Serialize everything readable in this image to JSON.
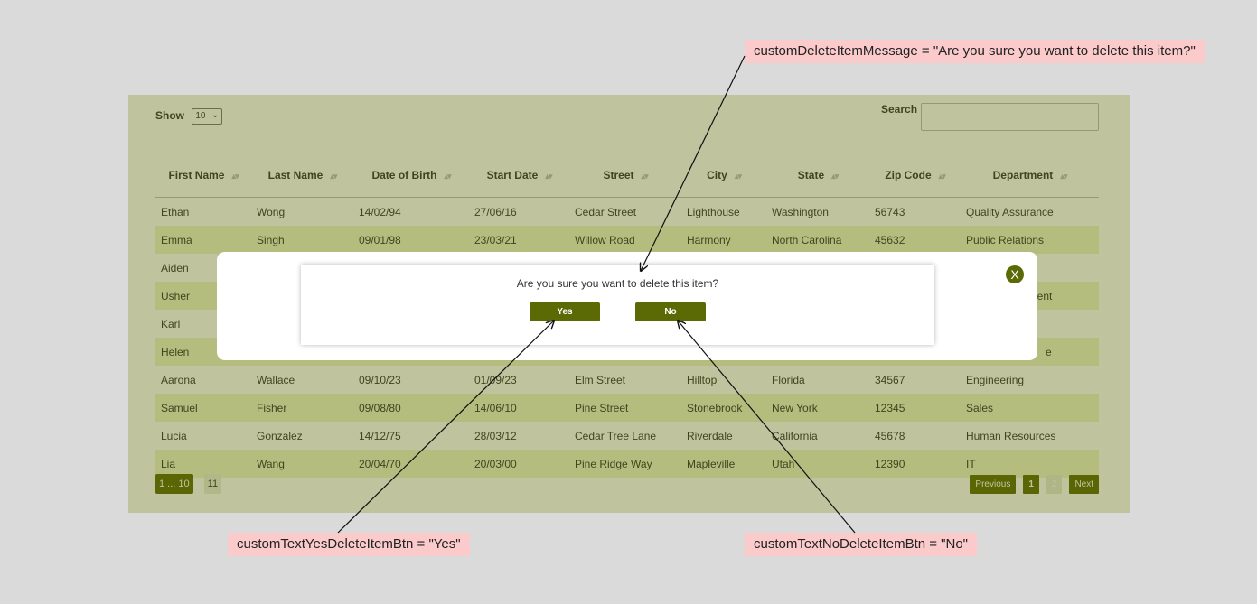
{
  "annotations": {
    "delete_message": "customDeleteItemMessage = \"Are you sure you want to delete this item?\"",
    "yes_button": "customTextYesDeleteItemBtn = \"Yes\"",
    "no_button": "customTextNoDeleteItemBtn = \"No\""
  },
  "controls": {
    "show_label": "Show",
    "show_value": "10",
    "search_label": "Search"
  },
  "table": {
    "headers": [
      "First Name",
      "Last Name",
      "Date of Birth",
      "Start Date",
      "Street",
      "City",
      "State",
      "Zip Code",
      "Department"
    ],
    "rows": [
      [
        "Ethan",
        "Wong",
        "14/02/94",
        "27/06/16",
        "Cedar Street",
        "Lighthouse",
        "Washington",
        "56743",
        "Quality Assurance"
      ],
      [
        "Emma",
        "Singh",
        "09/01/98",
        "23/03/21",
        "Willow Road",
        "Harmony",
        "North Carolina",
        "45632",
        "Public Relations"
      ],
      [
        "Aiden",
        "",
        "",
        "",
        "",
        "",
        "",
        "",
        ""
      ],
      [
        "Usher",
        "",
        "",
        "",
        "",
        "",
        "",
        "",
        "ement"
      ],
      [
        "Karl",
        "",
        "",
        "",
        "",
        "",
        "",
        "",
        ""
      ],
      [
        "Helen",
        "",
        "",
        "",
        "",
        "",
        "",
        "",
        "e"
      ],
      [
        "Aarona",
        "Wallace",
        "09/10/23",
        "01/09/23",
        "Elm Street",
        "Hilltop",
        "Florida",
        "34567",
        "Engineering"
      ],
      [
        "Samuel",
        "Fisher",
        "09/08/80",
        "14/06/10",
        "Pine Street",
        "Stonebrook",
        "New York",
        "12345",
        "Sales"
      ],
      [
        "Lucia",
        "Gonzalez",
        "14/12/75",
        "28/03/12",
        "Cedar Tree Lane",
        "Riverdale",
        "California",
        "45678",
        "Human Resources"
      ],
      [
        "Lia",
        "Wang",
        "20/04/70",
        "20/03/00",
        "Pine Ridge Way",
        "Mapleville",
        "Utah",
        "12390",
        "IT"
      ]
    ]
  },
  "pagination": {
    "left": [
      "1 ... 10",
      "11"
    ],
    "previous": "Previous",
    "pages": [
      "1",
      "2"
    ],
    "next": "Next"
  },
  "modal": {
    "message": "Are you sure you want to delete this item?",
    "yes_label": "Yes",
    "no_label": "No",
    "close_label": "X"
  },
  "colors": {
    "accent": "#5b6a05",
    "stripe": "#eef4cc",
    "annotation_bg": "#fbcaca"
  }
}
